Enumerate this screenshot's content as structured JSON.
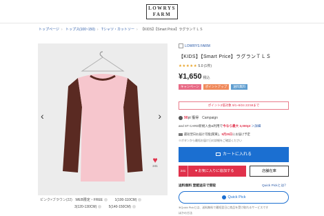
{
  "header": {
    "logo_line1": "LOWRYS",
    "logo_line2": "FARM"
  },
  "breadcrumb": [
    "トップページ",
    "トップス(100~150)",
    "Tシャツ・カットソー",
    "【KIDS】【Smart Price】ラグランＴＬＳ"
  ],
  "gallery": {
    "prev_icon": "‹",
    "next_icon": "›",
    "fav_count": "241"
  },
  "variants": {
    "color": "ピンク×ブラウン(22)",
    "row1": [
      "WEB限定・FREE",
      "1(100-110CM)"
    ],
    "row2": [
      "3(120-130CM)",
      "5(140-150CM)"
    ]
  },
  "product": {
    "brand": "LOWRYS FARM",
    "title": "【KIDS】【Smart Price】ラグランＴＬＳ",
    "stars": "★★★★★",
    "rating": "5.0 (1件)",
    "price": "¥1,650",
    "tax": "税込",
    "badges": [
      "キャンペーン",
      "ポイントアップ",
      "送料無料"
    ]
  },
  "point_notice": "ポイント2倍対象 9/1~9/24 23:59まで",
  "campaign": {
    "pt": "90",
    "pt_unit": "pt",
    "label": "獲得",
    "label2": "Campaign"
  },
  "stcard": {
    "text": "and ST CARD新規入会&利用で",
    "highlight": "今なら最大 3,000pt",
    "link": "＞詳細"
  },
  "shipping": {
    "text": "最短翌日お届け可能(関東)。",
    "highlight": "9月25日",
    "suffix": "にお届け予定"
  },
  "note": "※ボタンから最短お届け日の詳細をご確認ください",
  "buttons": {
    "cart": "カートに入れる",
    "fav_count": "241",
    "fav": "お気に入りに追加する",
    "store": "店舗在庫"
  },
  "free_ship": "送料無料 翌配送日で受取",
  "quick_help": "Quick Pickとは？",
  "quick_pick": "Quick Pick",
  "quick_note": "※Quick Pickとは、送料無料で最短翌日に商品を受け取れるサービスです",
  "more": "ほかの方法"
}
